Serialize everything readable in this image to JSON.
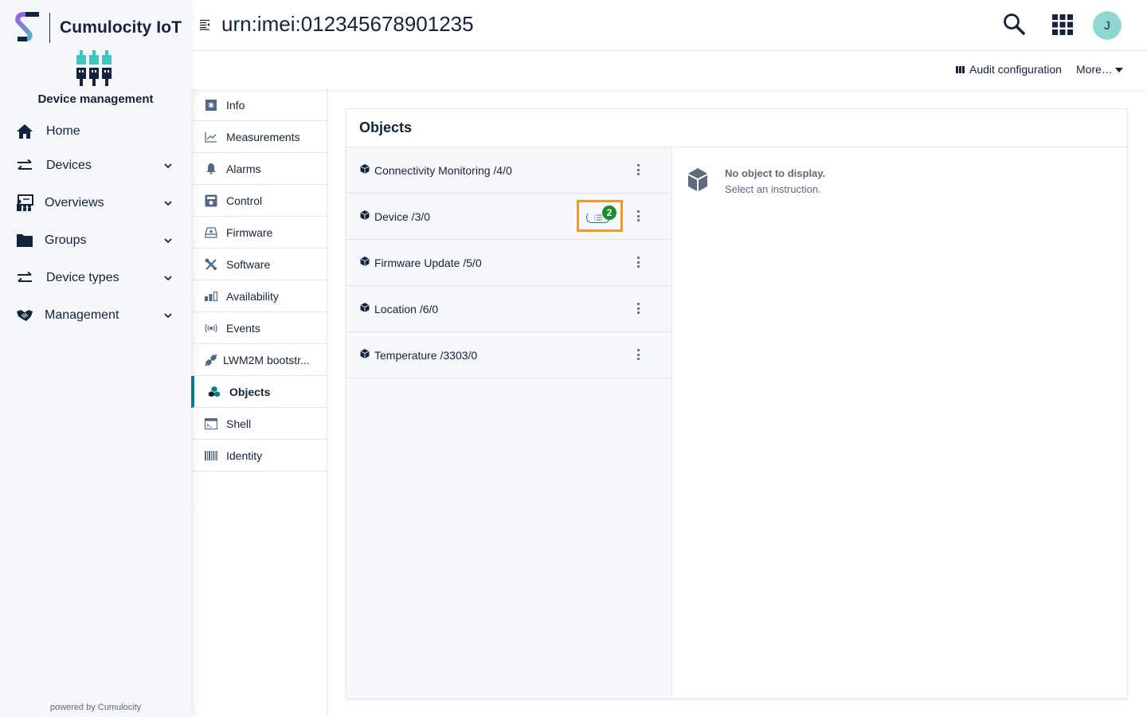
{
  "brand": {
    "name": "Cumulocity IoT",
    "app_name": "Device management",
    "powered_by": "powered by Cumulocity"
  },
  "navigator": {
    "items": [
      {
        "label": "Home",
        "icon": "home-icon",
        "expandable": false
      },
      {
        "label": "Devices",
        "icon": "exchange-arrows-icon",
        "expandable": true
      },
      {
        "label": "Overviews",
        "icon": "presentation-icon",
        "expandable": true
      },
      {
        "label": "Groups",
        "icon": "folder-icon",
        "expandable": true
      },
      {
        "label": "Device types",
        "icon": "exchange-arrows-icon",
        "expandable": true
      },
      {
        "label": "Management",
        "icon": "handshake-icon",
        "expandable": true
      }
    ]
  },
  "header": {
    "title": "urn:imei:012345678901235",
    "avatar_initial": "J"
  },
  "actionbar": {
    "audit_label": "Audit configuration",
    "more_label": "More…"
  },
  "tabs": {
    "items": [
      {
        "label": "Info",
        "icon": "info-asterisk-icon",
        "active": false
      },
      {
        "label": "Measurements",
        "icon": "line-chart-icon",
        "active": false
      },
      {
        "label": "Alarms",
        "icon": "bell-icon",
        "active": false
      },
      {
        "label": "Control",
        "icon": "control-panel-icon",
        "active": false
      },
      {
        "label": "Firmware",
        "icon": "firmware-tray-icon",
        "active": false
      },
      {
        "label": "Software",
        "icon": "tools-icon",
        "active": false
      },
      {
        "label": "Availability",
        "icon": "signal-bars-icon",
        "active": false
      },
      {
        "label": "Events",
        "icon": "broadcast-icon",
        "active": false
      },
      {
        "label": "LWM2M bootstr...",
        "icon": "plug-icon",
        "active": false
      },
      {
        "label": "Objects",
        "icon": "cubes-icon",
        "active": true
      },
      {
        "label": "Shell",
        "icon": "terminal-icon",
        "active": false
      },
      {
        "label": "Identity",
        "icon": "barcode-icon",
        "active": false
      }
    ]
  },
  "objects": {
    "title": "Objects",
    "rows": [
      {
        "label": "Connectivity Monitoring /4/0",
        "observations": null
      },
      {
        "label": "Device /3/0",
        "observations": 2
      },
      {
        "label": "Firmware Update /5/0",
        "observations": null
      },
      {
        "label": "Location /6/0",
        "observations": null
      },
      {
        "label": "Temperature /3303/0",
        "observations": null
      }
    ],
    "empty_title": "No object to display.",
    "empty_subtitle": "Select an instruction."
  },
  "colors": {
    "accent": "#107a84",
    "highlight": "#f39a1e",
    "badge": "#1a8d2e",
    "avatar": "#8fd8d2",
    "text": "#14233c"
  }
}
